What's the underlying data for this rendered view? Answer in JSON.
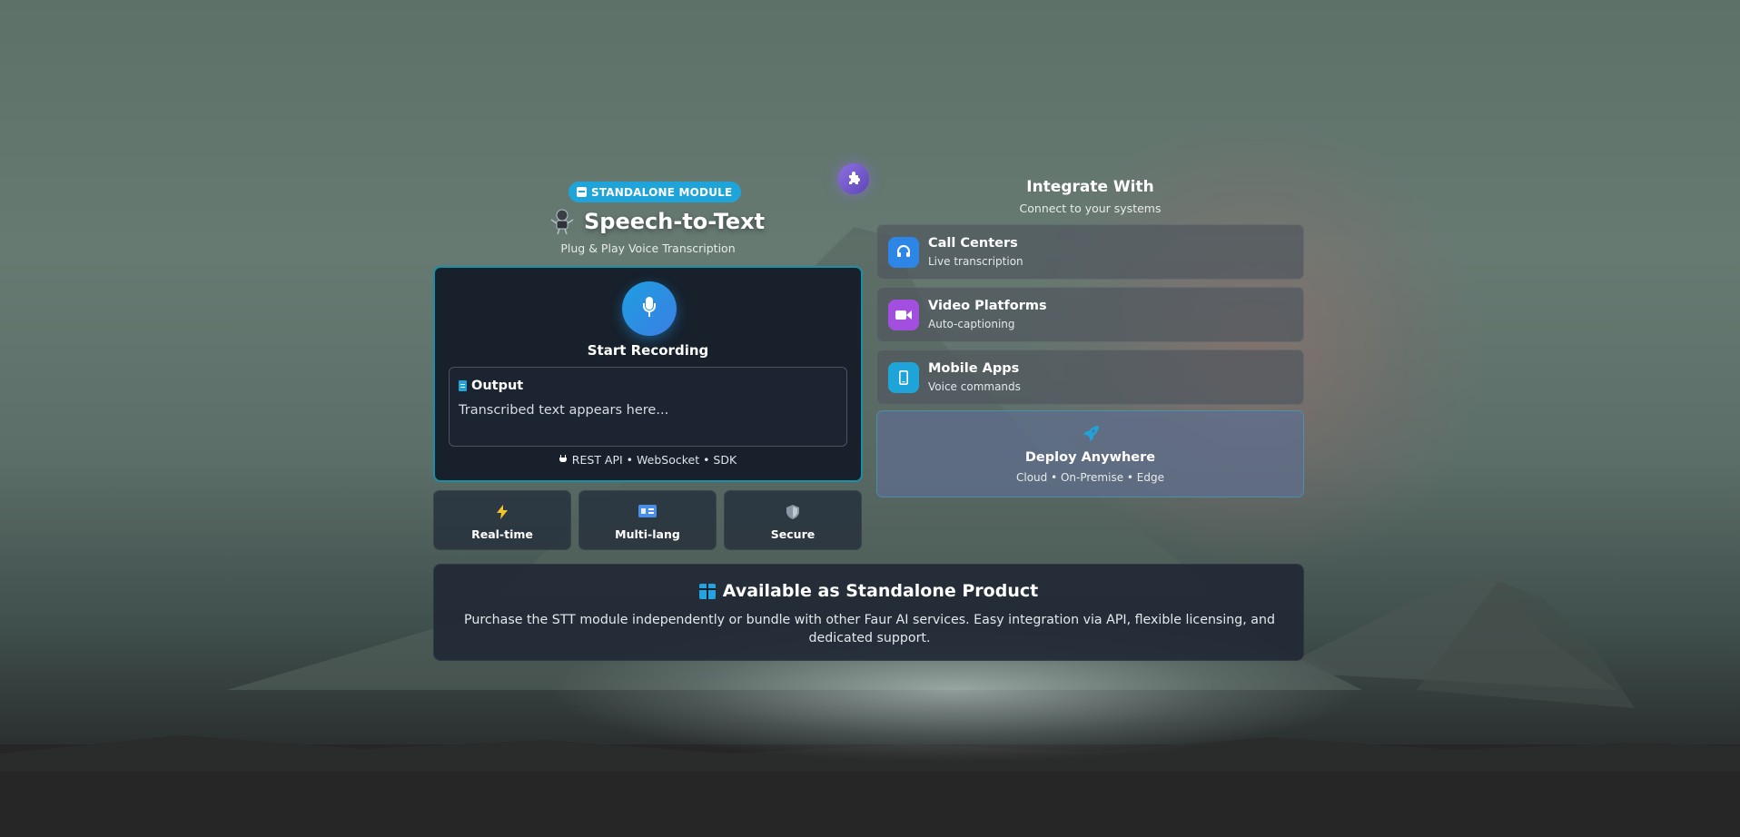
{
  "header": {
    "badge_label": "STANDALONE MODULE",
    "title": "Speech-to-Text",
    "subtitle": "Plug & Play Voice Transcription"
  },
  "recorder": {
    "start_label": "Start Recording",
    "output_title": "Output",
    "output_placeholder": "Transcribed text appears here...",
    "api_line": "REST API • WebSocket • SDK"
  },
  "features": [
    {
      "label": "Real-time",
      "icon": "lightning-icon"
    },
    {
      "label": "Multi-lang",
      "icon": "language-icon"
    },
    {
      "label": "Secure",
      "icon": "shield-icon"
    }
  ],
  "integrations": {
    "title": "Integrate With",
    "subtitle": "Connect to your systems",
    "items": [
      {
        "name": "Call Centers",
        "desc": "Live transcription",
        "icon": "headset-icon",
        "color": "#2d86e6"
      },
      {
        "name": "Video Platforms",
        "desc": "Auto-captioning",
        "icon": "video-icon",
        "color": "#a24fe0"
      },
      {
        "name": "Mobile Apps",
        "desc": "Voice commands",
        "icon": "mobile-icon",
        "color": "#1fa4d9"
      }
    ],
    "deploy": {
      "title": "Deploy Anywhere",
      "subtitle": "Cloud • On-Premise • Edge",
      "icon": "rocket-icon"
    }
  },
  "product": {
    "title": "Available as Standalone Product",
    "text": "Purchase the STT module independently or bundle with other Faur AI services. Easy integration via API, flexible licensing, and dedicated support."
  },
  "colors": {
    "accent": "#1fa4d9",
    "card_bg": "#17202b",
    "card_border": "#1b8fa8",
    "puzzle": "#7a5ed0"
  }
}
